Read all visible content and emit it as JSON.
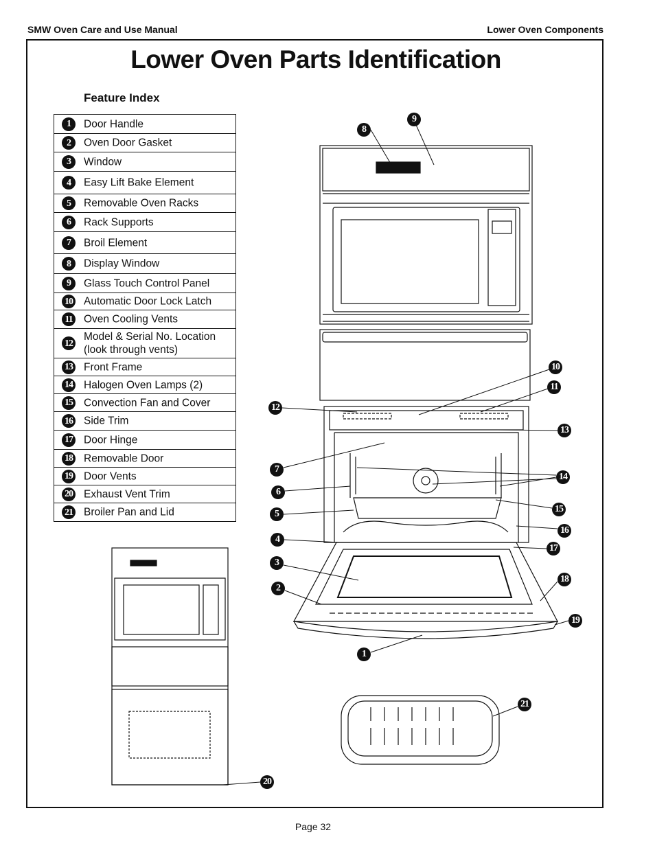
{
  "header": {
    "left": "SMW Oven Care and Use Manual",
    "right": "Lower Oven Components"
  },
  "title": "Lower Oven Parts Identification",
  "feature_index": {
    "heading": "Feature Index",
    "items": [
      {
        "num": "1",
        "label": "Door Handle"
      },
      {
        "num": "2",
        "label": "Oven Door Gasket"
      },
      {
        "num": "3",
        "label": "Window"
      },
      {
        "num": "4",
        "label": "Easy Lift Bake Element"
      },
      {
        "num": "5",
        "label": "Removable Oven Racks"
      },
      {
        "num": "6",
        "label": "Rack Supports"
      },
      {
        "num": "7",
        "label": "Broil Element"
      },
      {
        "num": "8",
        "label": "Display Window"
      },
      {
        "num": "9",
        "label": "Glass Touch Control Panel"
      },
      {
        "num": "10",
        "label": "Automatic Door Lock Latch"
      },
      {
        "num": "11",
        "label": "Oven Cooling Vents"
      },
      {
        "num": "12",
        "label": "Model & Serial No. Location\n(look through vents)"
      },
      {
        "num": "13",
        "label": "Front Frame"
      },
      {
        "num": "14",
        "label": "Halogen Oven Lamps (2)"
      },
      {
        "num": "15",
        "label": "Convection Fan and Cover"
      },
      {
        "num": "16",
        "label": "Side Trim"
      },
      {
        "num": "17",
        "label": "Door Hinge"
      },
      {
        "num": "18",
        "label": "Removable Door"
      },
      {
        "num": "19",
        "label": "Door Vents"
      },
      {
        "num": "20",
        "label": "Exhaust Vent Trim"
      },
      {
        "num": "21",
        "label": "Broiler Pan and Lid"
      }
    ]
  },
  "footer": {
    "page": "Page 32"
  }
}
